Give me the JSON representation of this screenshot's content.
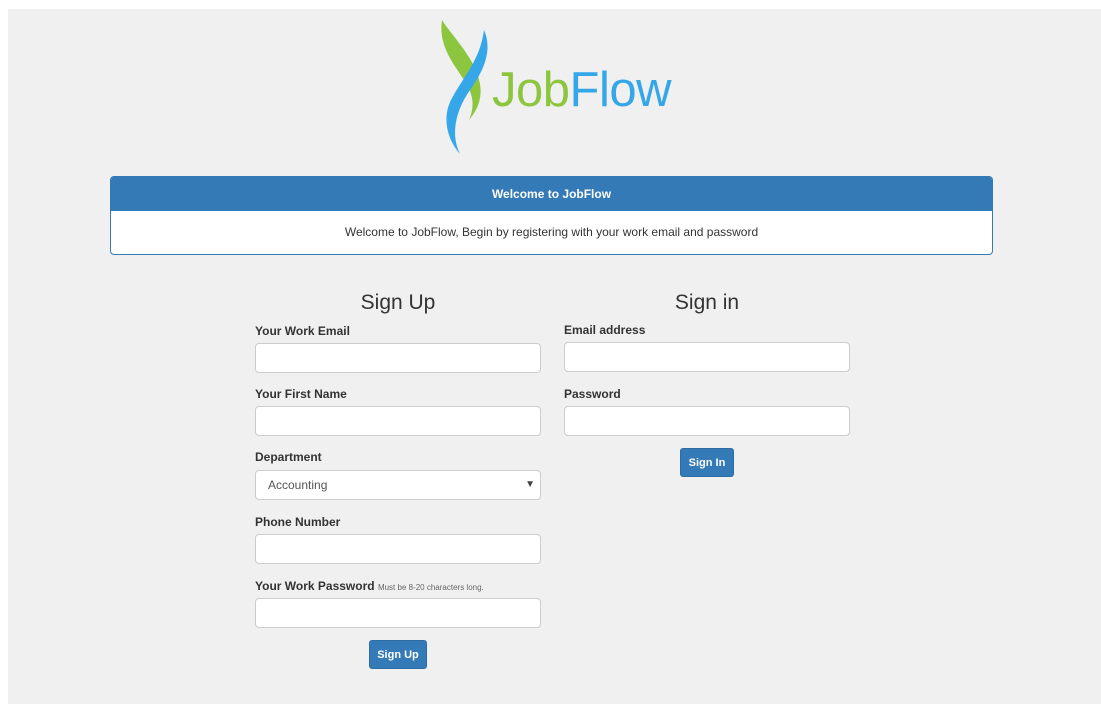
{
  "logo": {
    "text_part1": "Job",
    "text_part2": "Flow",
    "icon": "jobflow-logo-icon",
    "colors": {
      "green": "#8cc63f",
      "blue": "#35a7e8"
    }
  },
  "welcome_panel": {
    "heading": "Welcome to JobFlow",
    "body": "Welcome to JobFlow, Begin by registering with your work email and password",
    "accent": "#337ab7"
  },
  "signup": {
    "title": "Sign Up",
    "work_email_label": "Your Work Email",
    "work_email_value": "",
    "first_name_label": "Your First Name",
    "first_name_value": "",
    "department_label": "Department",
    "department_selected": "Accounting",
    "phone_label": "Phone Number",
    "phone_value": "",
    "password_label": "Your Work Password",
    "password_hint": "Must be 8-20 characters long.",
    "password_value": "",
    "button_label": "Sign Up"
  },
  "signin": {
    "title": "Sign in",
    "email_label": "Email address",
    "email_value": "",
    "password_label": "Password",
    "password_value": "",
    "button_label": "Sign In"
  }
}
